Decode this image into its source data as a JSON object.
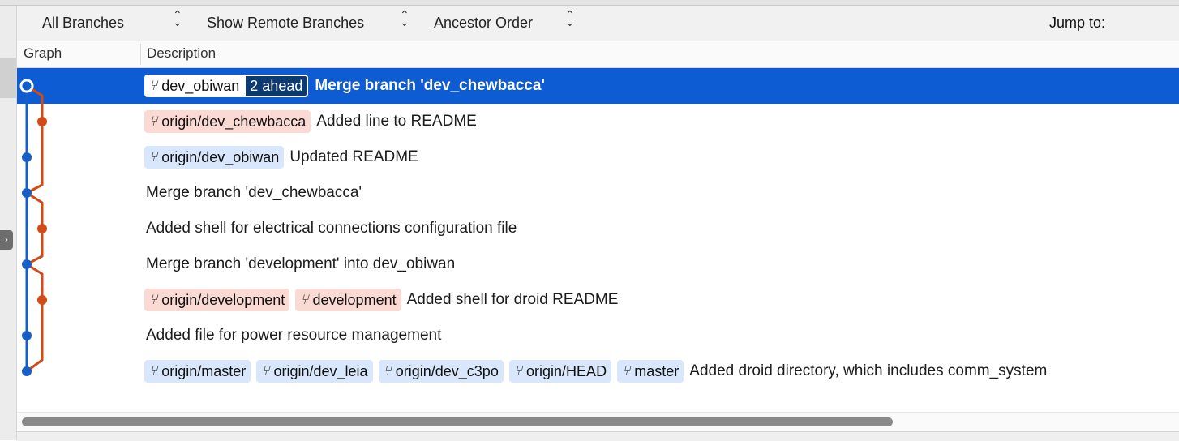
{
  "toolbar": {
    "branches_select": "All Branches",
    "remote_select": "Show Remote Branches",
    "order_select": "Ancestor Order",
    "jump_label": "Jump to:"
  },
  "columns": {
    "graph": "Graph",
    "description": "Description"
  },
  "colors": {
    "selection": "#0d5cd3",
    "lane_blue": "#1560c8",
    "lane_orange": "#d24a16",
    "local_badge": "#d8e7fb",
    "remote_badge": "#fadad2"
  },
  "commits": [
    {
      "refs": [
        {
          "name": "dev_obiwan",
          "style": "white"
        }
      ],
      "ahead": "2 ahead",
      "message": "Merge branch 'dev_chewbacca'",
      "lane": "blue",
      "selected": true
    },
    {
      "refs": [
        {
          "name": "origin/dev_chewbacca",
          "style": "red"
        }
      ],
      "message": "Added line to README",
      "lane": "orange"
    },
    {
      "refs": [
        {
          "name": "origin/dev_obiwan",
          "style": "blue"
        }
      ],
      "message": "Updated README",
      "lane": "blue"
    },
    {
      "refs": [],
      "message": "Merge branch 'dev_chewbacca'",
      "lane": "blue"
    },
    {
      "refs": [],
      "message": "Added shell for electrical connections configuration file",
      "lane": "orange"
    },
    {
      "refs": [],
      "message": "Merge branch 'development' into dev_obiwan",
      "lane": "blue"
    },
    {
      "refs": [
        {
          "name": "origin/development",
          "style": "red"
        },
        {
          "name": "development",
          "style": "red"
        }
      ],
      "message": "Added shell for droid README",
      "lane": "orange"
    },
    {
      "refs": [],
      "message": "Added file for power resource management",
      "lane": "blue"
    },
    {
      "refs": [
        {
          "name": "origin/master",
          "style": "blue"
        },
        {
          "name": "origin/dev_leia",
          "style": "blue"
        },
        {
          "name": "origin/dev_c3po",
          "style": "blue"
        },
        {
          "name": "origin/HEAD",
          "style": "blue"
        },
        {
          "name": "master",
          "style": "blue"
        }
      ],
      "message": "Added droid directory, which includes comm_system",
      "lane": "blue"
    }
  ],
  "icons": {
    "branch": "branch-icon",
    "updown": "up-down-chevron-icon"
  }
}
